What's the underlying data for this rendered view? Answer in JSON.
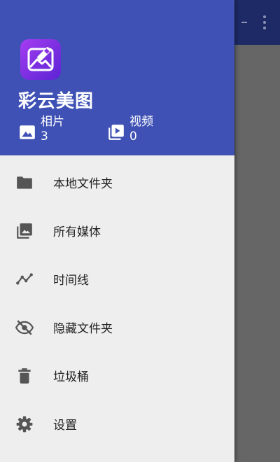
{
  "colors": {
    "header": "#3f51b5",
    "drawer_bg": "#eeeeee",
    "icon": "#555555",
    "text": "#212121"
  },
  "drawer": {
    "app_name": "彩云美图",
    "logo_icon": "photo-edit-icon",
    "stats": {
      "photos": {
        "label": "相片",
        "count": "3",
        "icon": "image-icon"
      },
      "videos": {
        "label": "视频",
        "count": "0",
        "icon": "video-library-icon"
      }
    },
    "menu": [
      {
        "label": "本地文件夹",
        "icon": "folder-icon"
      },
      {
        "label": "所有媒体",
        "icon": "photo-library-icon"
      },
      {
        "label": "时间线",
        "icon": "timeline-icon"
      },
      {
        "label": "隐藏文件夹",
        "icon": "visibility-off-icon"
      },
      {
        "label": "垃圾桶",
        "icon": "trash-icon"
      },
      {
        "label": "设置",
        "icon": "settings-icon"
      }
    ]
  }
}
